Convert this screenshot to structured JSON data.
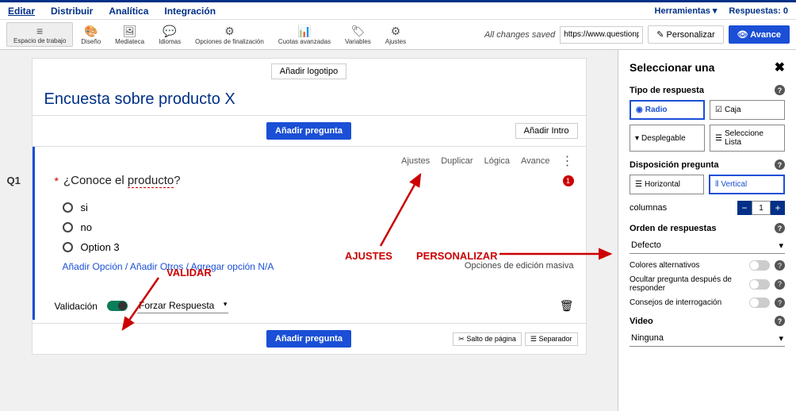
{
  "nav": {
    "tabs": [
      "Editar",
      "Distribuir",
      "Analítica",
      "Integración"
    ],
    "tools": "Herramientas ▾",
    "responses": "Respuestas: 0"
  },
  "toolbar": {
    "items": [
      "Espacio de trabajo",
      "Diseño",
      "Mediateca",
      "Idiomas",
      "Opciones de finalización",
      "Cuotas avanzadas",
      "Variables",
      "Ajustes"
    ],
    "icons": [
      "≡",
      "🎨",
      "🖼",
      "💬",
      "⚙",
      "📊",
      "🏷",
      "⚙"
    ],
    "saved": "All changes saved",
    "url": "https://www.questionpro...",
    "personalize": "Personalizar",
    "advance": "Avance"
  },
  "survey": {
    "add_logo": "Añadir logotipo",
    "title": "Encuesta sobre producto X",
    "add_question": "Añadir pregunta",
    "add_intro": "Añadir Intro",
    "page_break": "Salto de página",
    "separator": "Separador"
  },
  "question": {
    "num": "Q1",
    "actions": [
      "Ajustes",
      "Duplicar",
      "Lógica",
      "Avance"
    ],
    "text_prefix": "¿Conoce el ",
    "text_underlined": "producto",
    "text_suffix": "?",
    "badge": "1",
    "options": [
      "si",
      "no",
      "Option 3"
    ],
    "add_option": "Añadir Opción",
    "add_others": "Añadir Otros",
    "add_na": "Agregar opción N/A",
    "mass_edit": "Opciones de edición masiva",
    "validation_label": "Validación",
    "force_response": "Forzar Respuesta"
  },
  "sidebar": {
    "title": "Seleccionar una",
    "response_type": "Tipo de respuesta",
    "types": [
      "Radio",
      "Caja",
      "Desplegable",
      "Seleccione Lista"
    ],
    "layout_label": "Disposición pregunta",
    "layouts": [
      "Horizontal",
      "Vertical"
    ],
    "columns_label": "columnas",
    "columns_value": "1",
    "order_label": "Orden de respuestas",
    "order_value": "Defecto",
    "alt_colors": "Colores alternativos",
    "hide_after": "Ocultar pregunta después de responder",
    "question_tips": "Consejos de interrogación",
    "video_label": "Video",
    "video_value": "Ninguna"
  },
  "annotations": {
    "ajustes": "AJUSTES",
    "validar": "VALIDAR",
    "personalizar": "PERSONALIZAR"
  }
}
